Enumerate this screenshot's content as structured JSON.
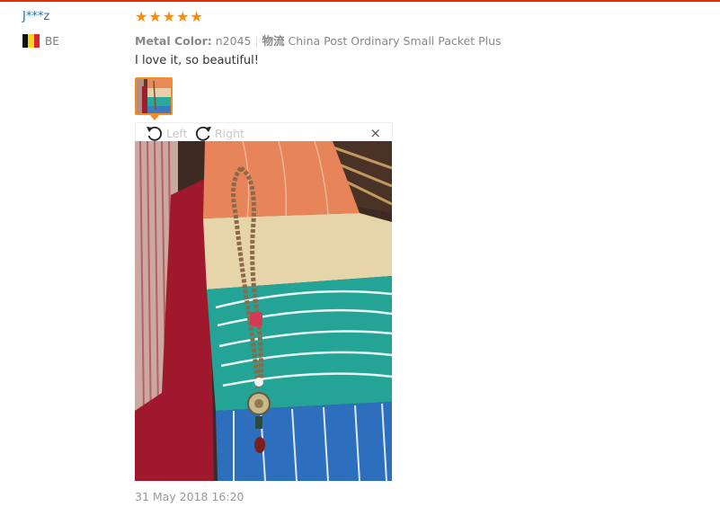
{
  "reviewer": {
    "name": "J***z",
    "country_code": "BE",
    "flag_colors": [
      "#111111",
      "#f5d41e",
      "#d9262e"
    ]
  },
  "rating": {
    "stars": 5,
    "max": 5,
    "color": "#ff8a00"
  },
  "attributes": {
    "color_label": "Metal Color:",
    "color_value": "n2045",
    "shipping_label": "物流",
    "shipping_value": "China Post Ordinary Small Packet Plus"
  },
  "feedback": {
    "text": "I love it, so beautiful!"
  },
  "viewer": {
    "rotate_left_label": "Left",
    "rotate_right_label": "Right",
    "close_symbol": "×",
    "thumb_border_color": "#f48c25"
  },
  "date": "31 May 2018 16:20",
  "accent_line_color": "#e62e04"
}
